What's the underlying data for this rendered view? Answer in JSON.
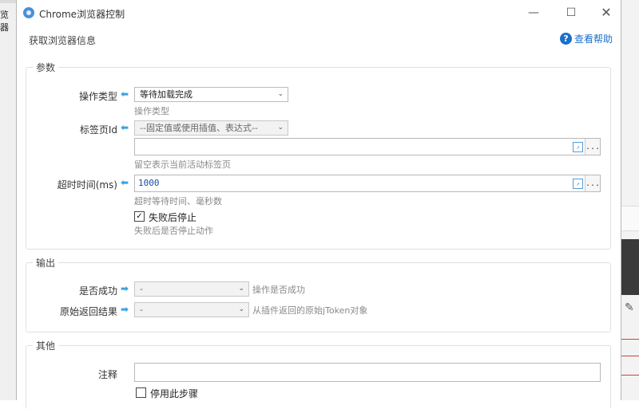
{
  "background": {
    "left_text": "览器",
    "pencil_icon": "pencil-icon"
  },
  "window": {
    "title": "Chrome浏览器控制",
    "minimize": "—",
    "maximize": "☐",
    "close": "✕"
  },
  "header": {
    "subtitle": "获取浏览器信息",
    "help_label": "查看帮助",
    "help_icon": "?"
  },
  "params": {
    "title": "参数",
    "op_type": {
      "label": "操作类型",
      "value": "等待加载完成",
      "hint": "操作类型"
    },
    "tab_id": {
      "label": "标签页Id",
      "select_value": "--固定值或使用插值、表达式--",
      "text_value": "",
      "hint": "留空表示当前活动标签页"
    },
    "timeout": {
      "label": "超时时间(ms)",
      "value": "1000",
      "hint": "超时等待时间、毫秒数"
    },
    "stop_on_fail": {
      "checked": true,
      "label": "失败后停止",
      "hint": "失败后是否停止动作"
    }
  },
  "output": {
    "title": "输出",
    "success": {
      "label": "是否成功",
      "value": "-",
      "hint": "操作是否成功"
    },
    "raw_result": {
      "label": "原始返回结果",
      "value": "-",
      "hint": "从插件返回的原始jToken对象"
    }
  },
  "other": {
    "title": "其他",
    "comment": {
      "label": "注释",
      "value": ""
    },
    "disable_step": {
      "checked": false,
      "label": "停用此步骤"
    }
  },
  "glyphs": {
    "arrow": "⬅",
    "arrow_right": "➡",
    "chevron": "⌄",
    "expand": "↗",
    "more": "...",
    "check": "✓"
  }
}
